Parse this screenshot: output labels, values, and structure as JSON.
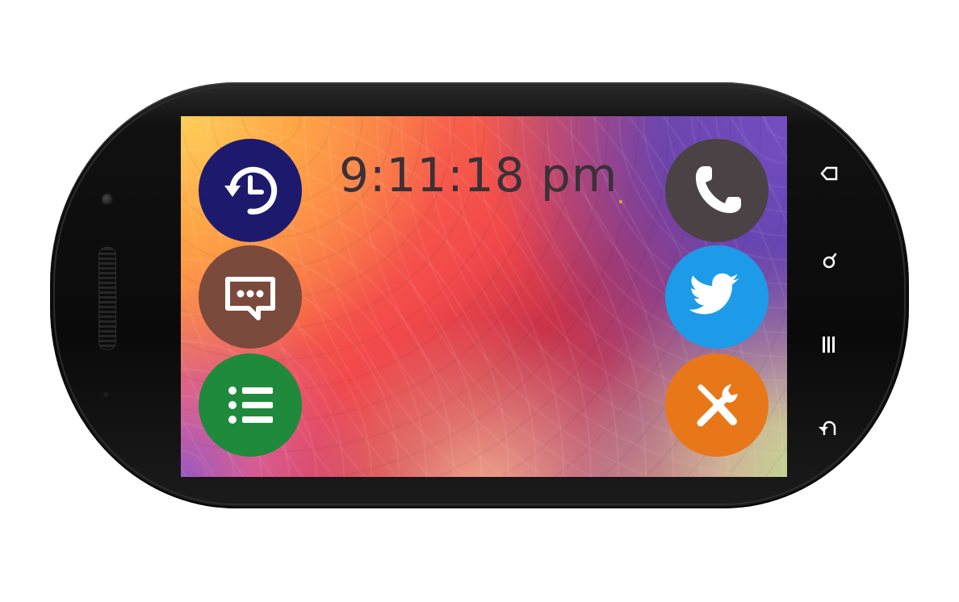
{
  "clock": {
    "time": "9:11:18 pm"
  },
  "apps": {
    "left": [
      {
        "name": "history-app-button",
        "icon": "clock-history-icon",
        "color": "#1d1a6e"
      },
      {
        "name": "messages-app-button",
        "icon": "chat-bubble-icon",
        "color": "#7a4a3c"
      },
      {
        "name": "list-app-button",
        "icon": "list-icon",
        "color": "#1f8a3c"
      }
    ],
    "right": [
      {
        "name": "phone-app-button",
        "icon": "phone-icon",
        "color": "#4a4244"
      },
      {
        "name": "twitter-app-button",
        "icon": "bird-icon",
        "color": "#1d9be8"
      },
      {
        "name": "settings-app-button",
        "icon": "tools-icon",
        "color": "#e8771a"
      }
    ]
  },
  "nav_keys": [
    {
      "name": "nav-home-key",
      "icon": "home-icon"
    },
    {
      "name": "nav-search-key",
      "icon": "search-icon"
    },
    {
      "name": "nav-menu-key",
      "icon": "menu-icon"
    },
    {
      "name": "nav-back-key",
      "icon": "back-icon"
    }
  ]
}
